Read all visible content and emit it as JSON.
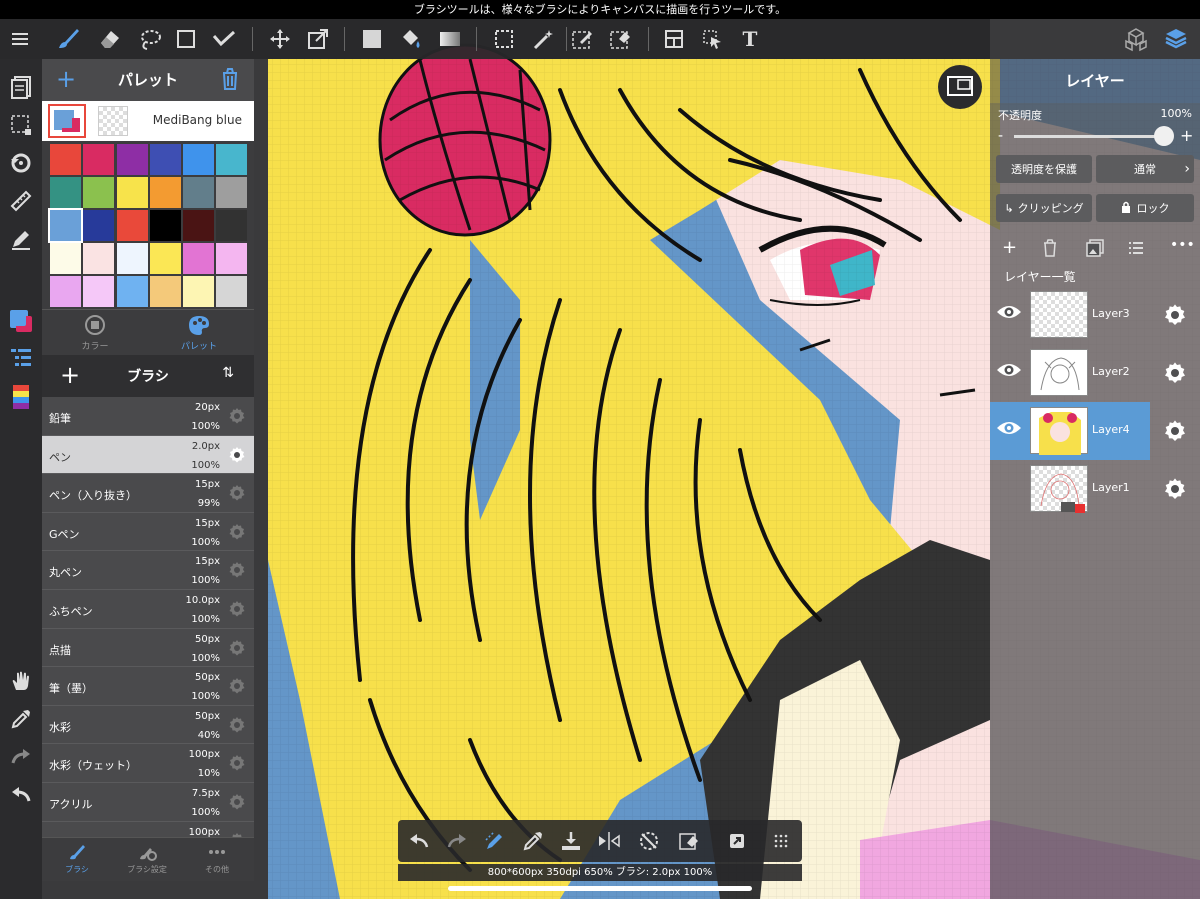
{
  "status_message": "ブラシツールは、様々なブラシによりキャンバスに描画を行うツールです。",
  "colors": {
    "accent": "#5b9bd5",
    "hair": "#f7e04b",
    "background_blue": "#6496c8",
    "skin": "#fae2e0",
    "line": "#111111"
  },
  "toolbar": {
    "left_tools": [
      "menu-icon",
      "brush-icon",
      "eraser-icon",
      "lasso-icon",
      "rectangle-select-icon",
      "magic-brush-icon"
    ],
    "mid_tools": [
      "move-icon",
      "transform-icon",
      "fill-color-icon",
      "bucket-icon",
      "gradient-icon",
      "select-icon",
      "magic-wand-icon",
      "select-pen-icon",
      "select-eraser-icon",
      "divide-icon",
      "operation-icon"
    ],
    "text_tool": "T"
  },
  "palette": {
    "title": "パレット",
    "palette_name": "MediBang blue",
    "swatches": [
      "#e8473b",
      "#d92b62",
      "#8e2ea5",
      "#3e4fb3",
      "#3f93ec",
      "#48b6cd",
      "#349283",
      "#8bc14e",
      "#f7e34b",
      "#f39b31",
      "#627e8b",
      "#9e9e9e",
      "#6aa0d8",
      "#273a9a",
      "#e9493a",
      "#000000",
      "#4a1414",
      "#323232",
      "#fdfbe8",
      "#fae3e3",
      "#eef5fe",
      "#fbe755",
      "#e274d3",
      "#f4b6f0",
      "#e9a7f0",
      "#f5c8f8",
      "#6fb2f1",
      "#f4c97a",
      "#fdf5b3",
      "#d6d6d6"
    ],
    "tab_color": "カラー",
    "tab_palette": "パレット"
  },
  "brush": {
    "title": "ブラシ",
    "items": [
      {
        "name": "鉛筆",
        "size": "20px",
        "opacity": "100%"
      },
      {
        "name": "ペン",
        "size": "2.0px",
        "opacity": "100%"
      },
      {
        "name": "ペン（入り抜き）",
        "size": "15px",
        "opacity": "99%"
      },
      {
        "name": "Gペン",
        "size": "15px",
        "opacity": "100%"
      },
      {
        "name": "丸ペン",
        "size": "15px",
        "opacity": "100%"
      },
      {
        "name": "ふちペン",
        "size": "10.0px",
        "opacity": "100%"
      },
      {
        "name": "点描",
        "size": "50px",
        "opacity": "100%"
      },
      {
        "name": "筆（墨）",
        "size": "50px",
        "opacity": "100%"
      },
      {
        "name": "水彩",
        "size": "50px",
        "opacity": "40%"
      },
      {
        "name": "水彩（ウェット）",
        "size": "100px",
        "opacity": "10%"
      },
      {
        "name": "アクリル",
        "size": "7.5px",
        "opacity": "100%"
      },
      {
        "name": "",
        "size": "100px",
        "opacity": ""
      }
    ],
    "selected_index": 1,
    "tab_brush": "ブラシ",
    "tab_settings": "ブラシ設定",
    "tab_other": "その他"
  },
  "layer": {
    "title": "レイヤー",
    "opacity_label": "不透明度",
    "opacity_value": "100%",
    "opacity": 1.0,
    "protect_alpha": "透明度を保護",
    "blend_mode": "通常",
    "clipping": "クリッピング",
    "lock": "ロック",
    "list_label": "レイヤー一覧",
    "layers": [
      {
        "name": "Layer3",
        "selected": false
      },
      {
        "name": "Layer2",
        "selected": false
      },
      {
        "name": "Layer4",
        "selected": true
      },
      {
        "name": "Layer1",
        "selected": false
      }
    ]
  },
  "status_bar": "800*600px 350dpi 650% ブラシ: 2.0px 100%"
}
